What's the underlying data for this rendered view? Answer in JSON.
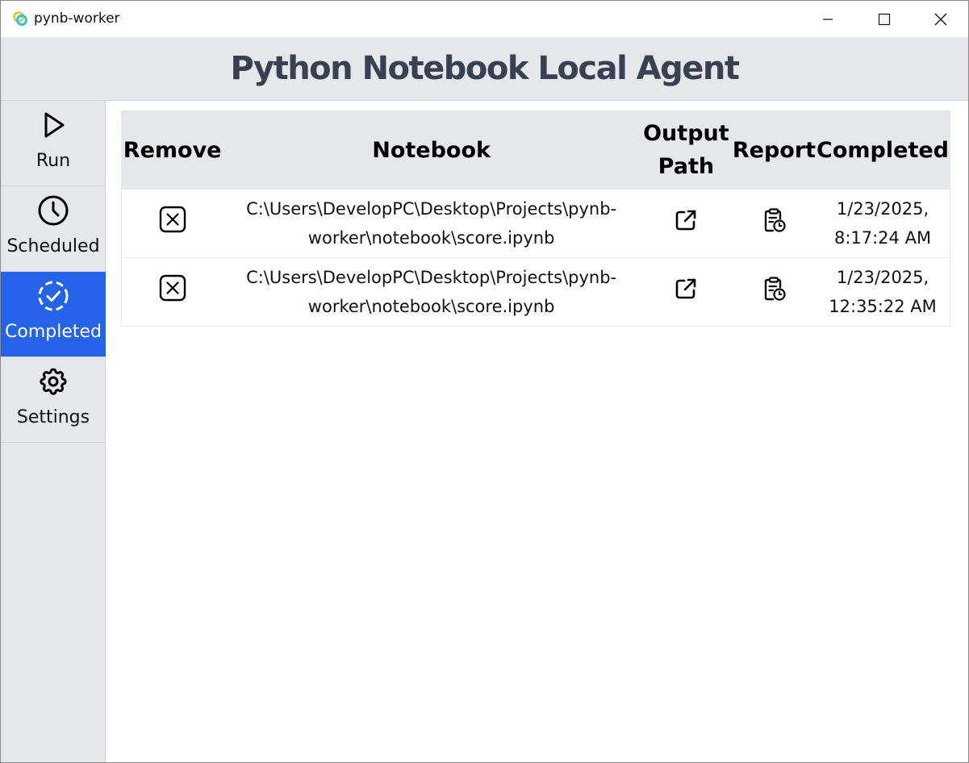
{
  "window": {
    "title": "pynb-worker"
  },
  "header": {
    "title": "Python Notebook Local Agent"
  },
  "sidebar": {
    "items": [
      {
        "label": "Run",
        "icon": "play-icon",
        "active": false
      },
      {
        "label": "Scheduled",
        "icon": "clock-icon",
        "active": false
      },
      {
        "label": "Completed",
        "icon": "dashed-check-circle-icon",
        "active": true
      },
      {
        "label": "Settings",
        "icon": "gear-icon",
        "active": false
      }
    ]
  },
  "table": {
    "headers": {
      "remove": "Remove",
      "notebook": "Notebook",
      "output_path": "Output Path",
      "report": "Report",
      "completed": "Completed"
    },
    "rows": [
      {
        "notebook": "C:\\Users\\DevelopPC\\Desktop\\Projects\\pynb-worker\\notebook\\score.ipynb",
        "completed": "1/23/2025, 8:17:24 AM"
      },
      {
        "notebook": "C:\\Users\\DevelopPC\\Desktop\\Projects\\pynb-worker\\notebook\\score.ipynb",
        "completed": "1/23/2025, 12:35:22 AM"
      }
    ]
  },
  "colors": {
    "accent": "#2563eb",
    "sidebar_bg": "#e5e7eb",
    "header_text": "#374151"
  }
}
